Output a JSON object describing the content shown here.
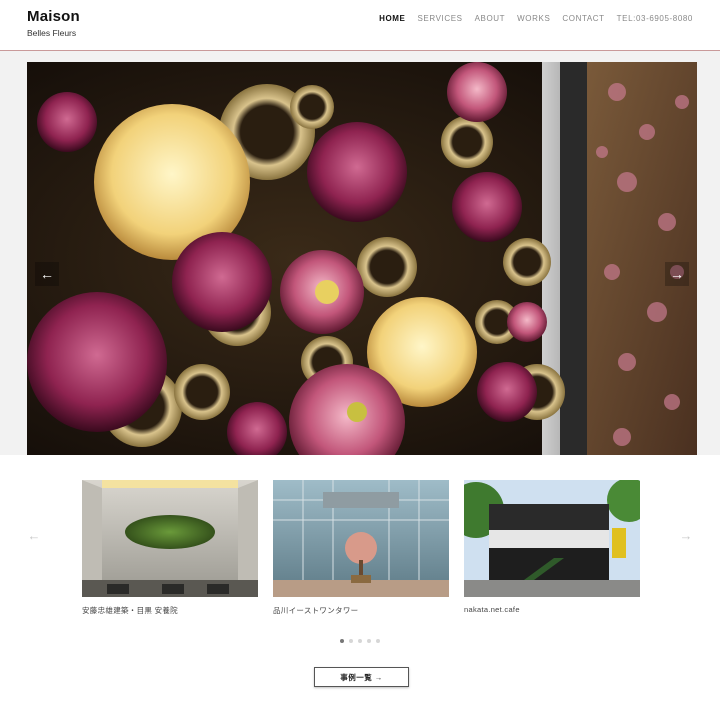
{
  "header": {
    "brand_name": "Maison",
    "brand_sub": "Belles Fleurs",
    "nav": [
      {
        "label": "HOME"
      },
      {
        "label": "SERVICES"
      },
      {
        "label": "ABOUT"
      },
      {
        "label": "WORKS"
      },
      {
        "label": "CONTACT"
      },
      {
        "label": "TEL:03-6905-8080"
      }
    ]
  },
  "hero": {
    "prev_icon": "arrow-left-icon",
    "next_icon": "arrow-right-icon"
  },
  "works": {
    "prev_icon": "chevron-left-icon",
    "next_icon": "chevron-right-icon",
    "cards": [
      {
        "caption": "安藤忠雄建築・目黒 安養院"
      },
      {
        "caption": "品川イーストワンタワー"
      },
      {
        "caption": "nakata.net.cafe"
      }
    ],
    "dots_total": 5,
    "dots_active": 1,
    "list_button": "事例一覧 →"
  },
  "colors": {
    "header_rule": "#c99a9a",
    "accent_dark": "#111111",
    "nav_muted": "#888888"
  }
}
